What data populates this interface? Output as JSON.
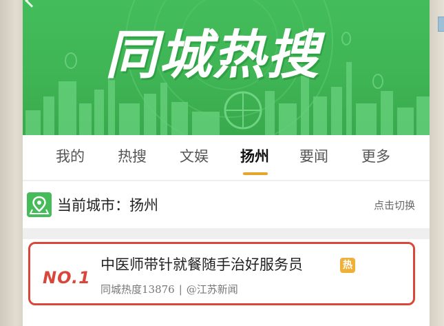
{
  "banner": {
    "title": "同城热搜"
  },
  "tabs": [
    {
      "label": "我的",
      "active": false
    },
    {
      "label": "热搜",
      "active": false
    },
    {
      "label": "文娱",
      "active": false
    },
    {
      "label": "扬州",
      "active": true
    },
    {
      "label": "要闻",
      "active": false
    },
    {
      "label": "更多",
      "active": false
    }
  ],
  "city": {
    "label": "当前城市：扬州",
    "switch_label": "点击切换",
    "icon": "location-pin-icon"
  },
  "news": [
    {
      "rank": "NO.1",
      "title": "中医师带针就餐随手治好服务员",
      "badge": "热",
      "heat": "同城热度13876",
      "separator": "|",
      "source": "@江苏新闻"
    }
  ],
  "colors": {
    "banner_green": "#43bd5b",
    "active_underline": "#e8a52b",
    "highlight_red": "#d9463a",
    "hot_badge": "#efb03a"
  }
}
